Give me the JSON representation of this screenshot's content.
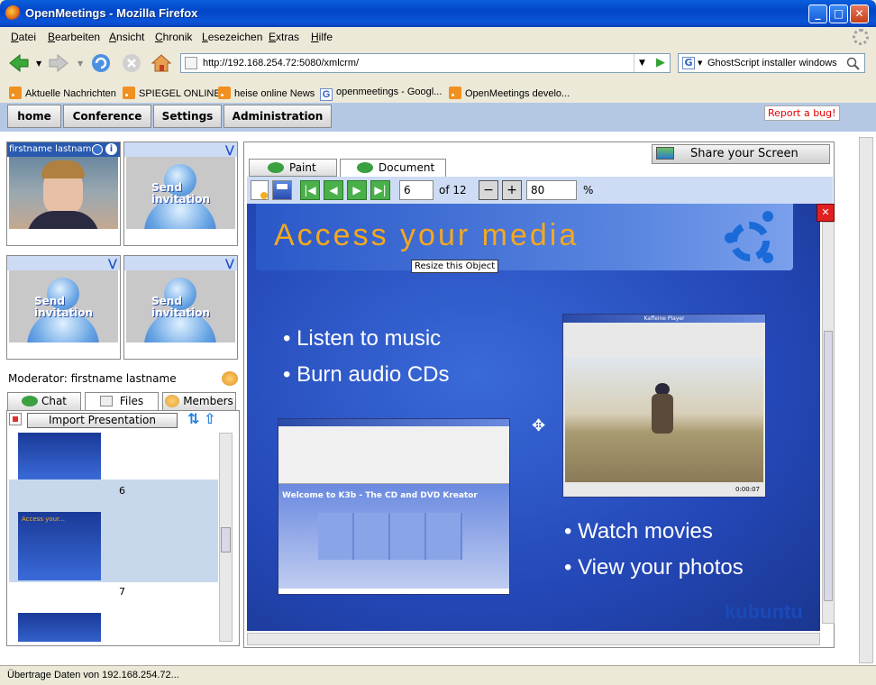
{
  "window": {
    "title": "OpenMeetings - Mozilla Firefox"
  },
  "menu": [
    "Datei",
    "Bearbeiten",
    "Ansicht",
    "Chronik",
    "Lesezeichen",
    "Extras",
    "Hilfe"
  ],
  "navbar": {
    "url": "http://192.168.254.72:5080/xmlcrm/",
    "search_value": "GhostScript installer windows",
    "search_engine": "G"
  },
  "bookmarks": [
    {
      "label": "Aktuelle Nachrichten",
      "icon": "rss-icon"
    },
    {
      "label": "SPIEGEL ONLINE",
      "icon": "rss-icon"
    },
    {
      "label": "heise online News",
      "icon": "rss-icon"
    },
    {
      "label": "openmeetings - Googl...",
      "icon": "google-icon"
    },
    {
      "label": "OpenMeetings develo...",
      "icon": "rss-icon"
    }
  ],
  "app_nav": [
    "home",
    "Conference",
    "Settings",
    "Administration"
  ],
  "report_bug": "Report a bug!",
  "pods": [
    {
      "header": "firstname lastname",
      "type": "video"
    },
    {
      "header": "",
      "invite": "Send invitation"
    },
    {
      "header": "",
      "invite": "Send invitation"
    },
    {
      "header": "",
      "invite": "Send invitation"
    }
  ],
  "moderator": "Moderator: firstname lastname",
  "left_tabs": [
    "Chat",
    "Files",
    "Members"
  ],
  "import_presentation": "Import Presentation",
  "slide_list": [
    "6",
    "7"
  ],
  "doc_tabs": [
    "Paint",
    "Document"
  ],
  "share_screen": "Share your Screen",
  "doc_toolbar": {
    "page": "6",
    "of_label": "of 12",
    "zoom": "80",
    "zoom_unit": "%"
  },
  "slide": {
    "title": "Access your media",
    "tooltip": "Resize this Object",
    "bullets_top": [
      "Listen to music",
      "Burn audio CDs"
    ],
    "bullets_bottom": [
      "Watch movies",
      "View your photos"
    ],
    "k3b_banner": "Welcome to K3b - The CD and DVD Kreator",
    "player_title": "Kaffeine Player",
    "player_time": "0:00:07",
    "brand": "kubuntu"
  },
  "status": "Übertrage Daten von 192.168.254.72..."
}
